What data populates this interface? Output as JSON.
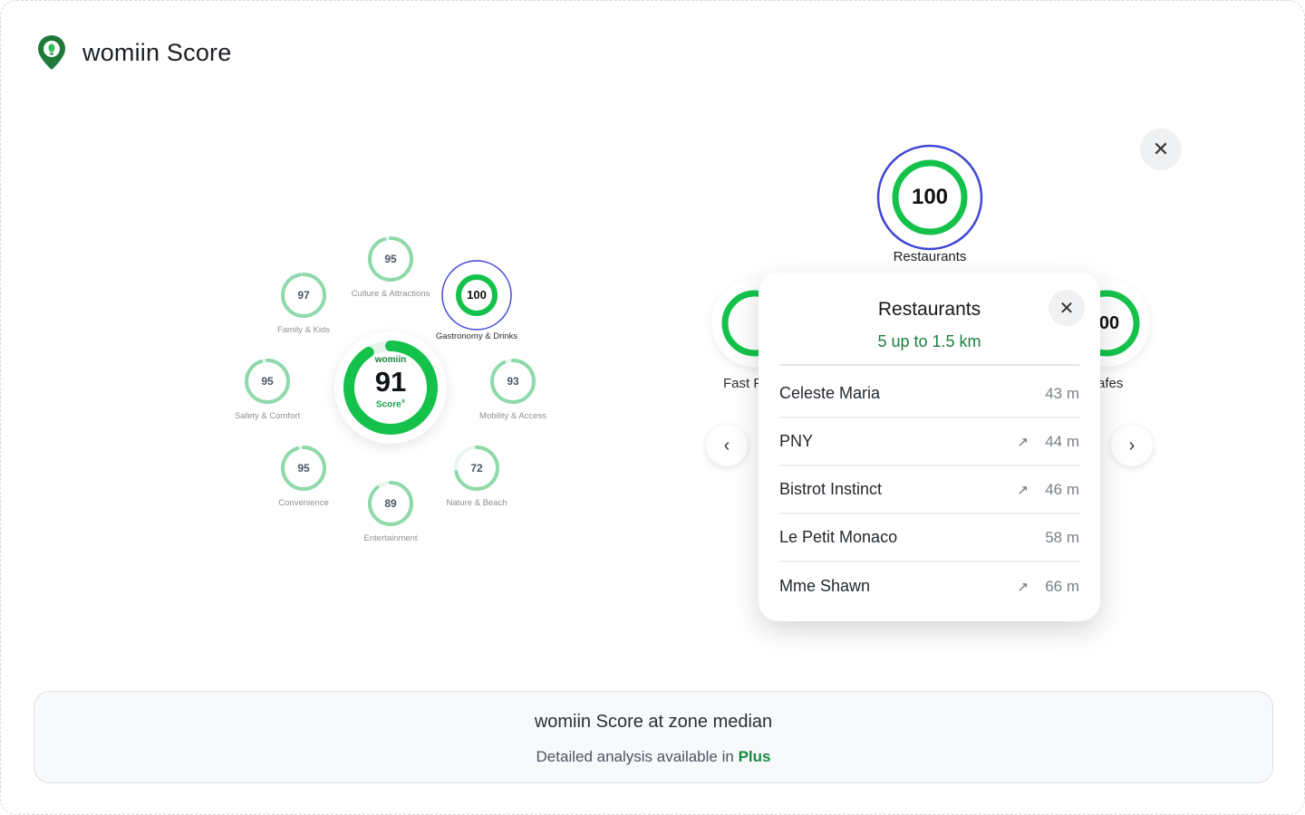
{
  "app": {
    "title": "womiin Score",
    "logo_icon": "map-pin-bulb-icon"
  },
  "colors": {
    "brand_green": "#16a34a",
    "light_green": "#86d4a7",
    "active_blue": "#4046d6"
  },
  "overall": {
    "brand": "womiin",
    "score": "91",
    "label": "Score",
    "progress": 0.91
  },
  "categories": [
    {
      "id": "culture",
      "label": "Culture & Attractions",
      "score": "95",
      "progress": 0.95,
      "active": false
    },
    {
      "id": "gastronomy",
      "label": "Gastronomy & Drinks",
      "score": "100",
      "progress": 1.0,
      "active": true
    },
    {
      "id": "mobility",
      "label": "Mobility & Access",
      "score": "93",
      "progress": 0.93,
      "active": false
    },
    {
      "id": "nature",
      "label": "Nature & Beach",
      "score": "72",
      "progress": 0.72,
      "active": false
    },
    {
      "id": "entertainment",
      "label": "Entertainment",
      "score": "89",
      "progress": 0.89,
      "active": false
    },
    {
      "id": "convenience",
      "label": "Convenience",
      "score": "95",
      "progress": 0.95,
      "active": false
    },
    {
      "id": "safety",
      "label": "Safety & Comfort",
      "score": "95",
      "progress": 0.95,
      "active": false
    },
    {
      "id": "family",
      "label": "Family & Kids",
      "score": "97",
      "progress": 0.97,
      "active": false
    }
  ],
  "carousel": {
    "selected": {
      "label": "Restaurants",
      "score": "100",
      "progress": 1.0
    },
    "prev": {
      "label": "Fast F",
      "score": "99",
      "progress": 0.99
    },
    "next": {
      "label": "afes",
      "score": "00",
      "progress": 1.0
    },
    "prev_icon": "chevron-left-icon",
    "next_icon": "chevron-right-icon",
    "close_icon": "close-icon"
  },
  "popup": {
    "title": "Restaurants",
    "subtitle": "5 up to 1.5 km",
    "places": [
      {
        "name": "Celeste Maria",
        "distance": "43 m",
        "external": false
      },
      {
        "name": "PNY",
        "distance": "44 m",
        "external": true
      },
      {
        "name": "Bistrot Instinct",
        "distance": "46 m",
        "external": true
      },
      {
        "name": "Le Petit Monaco",
        "distance": "58 m",
        "external": false
      },
      {
        "name": "Mme Shawn",
        "distance": "66 m",
        "external": true
      }
    ]
  },
  "footer": {
    "title": "womiin Score at zone median",
    "subtitle_prefix": "Detailed analysis available in",
    "subtitle_link": "Plus"
  }
}
